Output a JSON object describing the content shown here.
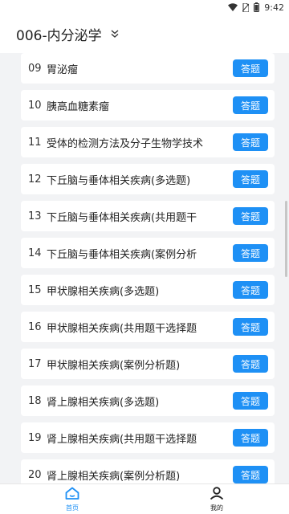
{
  "status": {
    "time": "9:42",
    "icons": [
      "wifi-icon",
      "sim-off-icon",
      "battery-icon"
    ]
  },
  "header": {
    "title": "006-内分泌学",
    "dropdown_icon": "chevron-down-icon"
  },
  "list": {
    "button_label": "答题",
    "items": [
      {
        "num": "09",
        "name": "胃泌瘤"
      },
      {
        "num": "10",
        "name": "胰高血糖素瘤"
      },
      {
        "num": "11",
        "name": "受体的检测方法及分子生物学技术"
      },
      {
        "num": "12",
        "name": "下丘脑与垂体相关疾病(多选题)"
      },
      {
        "num": "13",
        "name": "下丘脑与垂体相关疾病(共用题干"
      },
      {
        "num": "14",
        "name": "下丘脑与垂体相关疾病(案例分析"
      },
      {
        "num": "15",
        "name": "甲状腺相关疾病(多选题)"
      },
      {
        "num": "16",
        "name": "甲状腺相关疾病(共用题干选择题"
      },
      {
        "num": "17",
        "name": "甲状腺相关疾病(案例分析题)"
      },
      {
        "num": "18",
        "name": "肾上腺相关疾病(多选题)"
      },
      {
        "num": "19",
        "name": "肾上腺相关疾病(共用题干选择题"
      },
      {
        "num": "20",
        "name": "肾上腺相关疾病(案例分析题)"
      }
    ]
  },
  "tabs": [
    {
      "label": "首页",
      "icon": "home-icon",
      "active": true
    },
    {
      "label": "我的",
      "icon": "user-icon",
      "active": false
    }
  ],
  "colors": {
    "accent": "#1e90f5",
    "background": "#f2f3f5"
  }
}
